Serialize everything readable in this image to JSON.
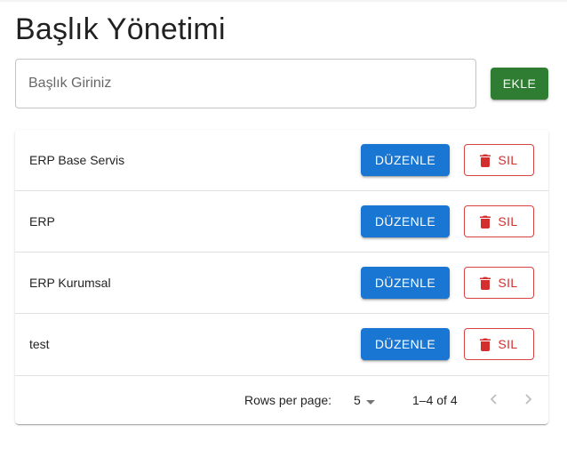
{
  "page": {
    "title": "Başlık Yönetimi"
  },
  "form": {
    "input_placeholder": "Başlık Giriniz",
    "input_value": "",
    "add_label": "EKLE"
  },
  "list": {
    "edit_label": "DÜZENLE",
    "delete_label": "SIL",
    "items": [
      {
        "label": "ERP Base Servis"
      },
      {
        "label": "ERP"
      },
      {
        "label": "ERP Kurumsal"
      },
      {
        "label": "test"
      }
    ]
  },
  "pagination": {
    "rows_per_page_label": "Rows per page:",
    "rows_per_page_value": "5",
    "range_text": "1–4 of 4"
  },
  "icons": {
    "delete": "trash-icon",
    "dropdown": "caret-down-icon",
    "prev": "chevron-left-icon",
    "next": "chevron-right-icon"
  },
  "colors": {
    "add_button": "#2e7d32",
    "edit_button": "#1976d2",
    "delete_button": "#d32f2f"
  }
}
